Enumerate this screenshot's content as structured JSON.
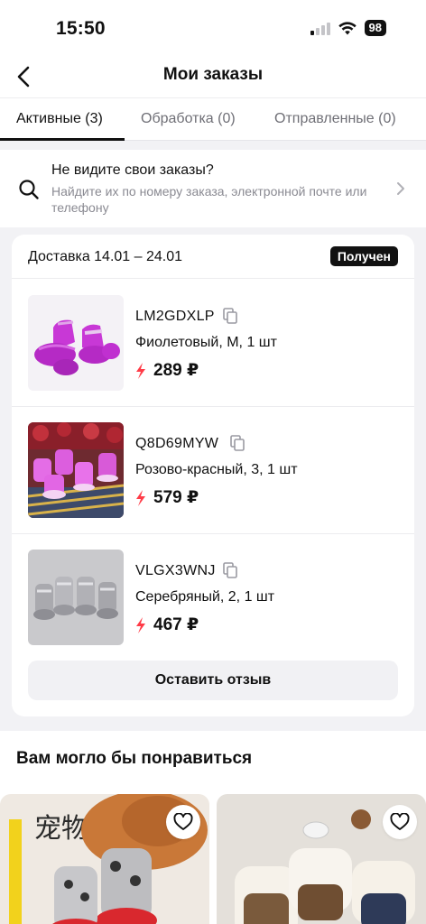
{
  "status": {
    "time": "15:50",
    "battery": "98"
  },
  "nav": {
    "title": "Мои заказы"
  },
  "tabs": [
    {
      "label": "Активные (3)",
      "active": true
    },
    {
      "label": "Обработка (0)",
      "active": false
    },
    {
      "label": "Отправленные (0)",
      "active": false
    }
  ],
  "find_orders": {
    "title": "Не видите свои заказы?",
    "subtitle": "Найдите их по номеру заказа, электронной почте или телефону"
  },
  "order": {
    "delivery": "Доставка 14.01 – 24.01",
    "status_badge": "Получен",
    "items": [
      {
        "code": "LM2GDXLP",
        "variant": "Фиолетовый, M, 1 шт",
        "price": "289 ₽",
        "image": "purple-pet-boots"
      },
      {
        "code": "Q8D69MYW",
        "variant": "Розово-красный, 3, 1 шт",
        "price": "579 ₽",
        "image": "pink-pet-boots"
      },
      {
        "code": "VLGX3WNJ",
        "variant": "Серебряный, 2, 1 шт",
        "price": "467 ₽",
        "image": "silver-pet-boots"
      }
    ],
    "review_button": "Оставить отзыв"
  },
  "recommendations": {
    "title": "Вам могло бы понравиться",
    "cards": [
      {
        "image": "dog-in-red-socks",
        "lettering": "宠物鞋"
      },
      {
        "image": "fluffy-pet-boots"
      }
    ]
  },
  "colors": {
    "accent_bolt": "#ff3b47",
    "badge_bg": "#111111"
  }
}
